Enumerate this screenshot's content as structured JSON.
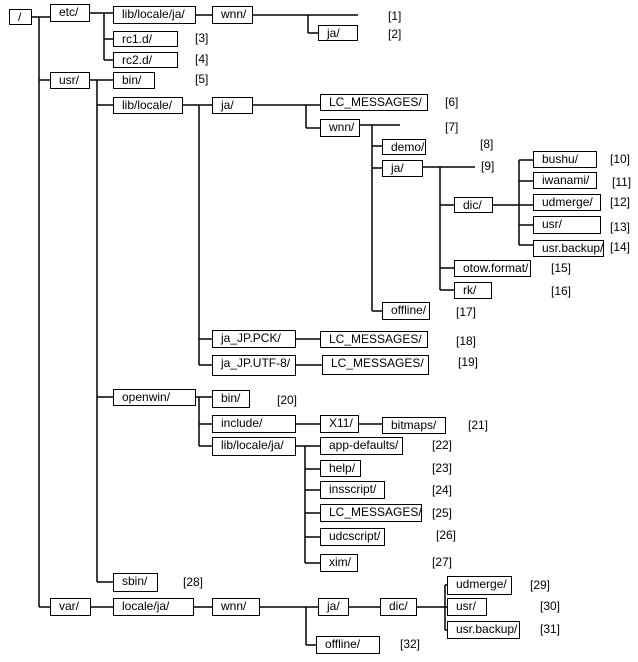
{
  "nodes": {
    "root": "/",
    "etc": "etc/",
    "etc_lib_locale_ja": "lib/locale/ja/",
    "etc_wnn": "wnn/",
    "etc_wnn_ja": "ja/",
    "rc1d": "rc1.d/",
    "rc2d": "rc2.d/",
    "usr": "usr/",
    "usr_bin": "bin/",
    "usr_lib_locale": "lib/locale/",
    "usr_ja": "ja/",
    "usr_ja_lcm": "LC_MESSAGES/",
    "usr_ja_wnn": "wnn/",
    "demo": "demo/",
    "wnn_ja": "ja/",
    "dic": "dic/",
    "bushu": "bushu/",
    "iwanami": "iwanami/",
    "udmerge": "udmerge/",
    "dic_usr": "usr/",
    "usr_backup": "usr.backup/",
    "otow": "otow.format/",
    "rk": "rk/",
    "offline": "offline/",
    "pck": "ja_JP.PCK/",
    "pck_lcm": "LC_MESSAGES/",
    "utf8": "ja_JP.UTF-8/",
    "utf8_lcm": "LC_MESSAGES/",
    "openwin": "openwin/",
    "ow_bin": "bin/",
    "ow_include": "include/",
    "x11": "X11/",
    "bitmaps": "bitmaps/",
    "ow_lib": "lib/locale/ja/",
    "appdef": "app-defaults/",
    "help": "help/",
    "insscript": "insscript/",
    "ow_lcm": "LC_MESSAGES/",
    "udcscript": "udcscript/",
    "xim": "xim/",
    "sbin": "sbin/",
    "var": "var/",
    "var_locale": "locale/ja/",
    "var_wnn": "wnn/",
    "var_ja": "ja/",
    "var_dic": "dic/",
    "var_udmerge": "udmerge/",
    "var_usr": "usr/",
    "var_usr_backup": "usr.backup/",
    "var_offline": "offline/"
  },
  "notes": [
    "[1]",
    "[2]",
    "[3]",
    "[4]",
    "[5]",
    "[6]",
    "[7]",
    "[8]",
    "[9]",
    "[10]",
    "[11]",
    "[12]",
    "[13]",
    "[14]",
    "[15]",
    "[16]",
    "[17]",
    "[18]",
    "[19]",
    "[20]",
    "[21]",
    "[22]",
    "[23]",
    "[24]",
    "[25]",
    "[26]",
    "[27]",
    "[28]",
    "[29]",
    "[30]",
    "[31]",
    "[32]"
  ]
}
